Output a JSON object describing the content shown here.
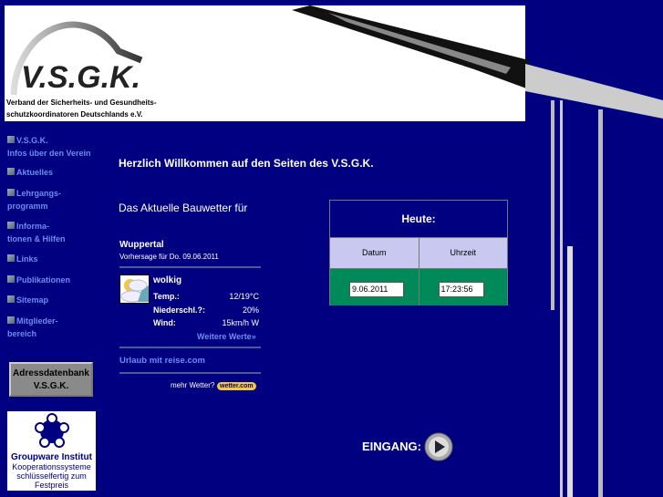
{
  "header": {
    "logo": "V.S.G.K.",
    "subtitle_line1": "Verband der Sicherheits- und Gesundheits-",
    "subtitle_line2": "schutzkoordinatoren Deutschlands e.V."
  },
  "nav": [
    {
      "l1": "V.S.G.K.",
      "l2": "Infos über den Verein"
    },
    {
      "l1": "Aktuelles"
    },
    {
      "l1": "Lehrgangs-",
      "l2": "programm"
    },
    {
      "l1": "Informa-",
      "l2": "tionen & Hilfen"
    },
    {
      "l1": "Links"
    },
    {
      "l1": "Publikationen"
    },
    {
      "l1": "Sitemap"
    },
    {
      "l1": "Mitglieder-",
      "l2": "bereich"
    }
  ],
  "adress_button": {
    "l1": "Adressdatenbank",
    "l2": "V.S.G.K."
  },
  "groupware": {
    "title": "Groupware Institut",
    "l1": "Kooperationssysteme",
    "l2": "schlüsselfertig zum",
    "l3": "Festpreis"
  },
  "main": {
    "welcome": "Herzlich Willkommen auf den Seiten des V.S.G.K.",
    "weather_heading": "Das Aktuelle Bauwetter für"
  },
  "weather": {
    "city": "Wuppertal",
    "forecast": "Vorhersage für Do. 09.06.2011",
    "condition": "wolkig",
    "rows": [
      {
        "k": "Temp.:",
        "v": "12/19°C"
      },
      {
        "k": "Niederschl.?:",
        "v": "20%"
      },
      {
        "k": "Wind:",
        "v": "15km/h W"
      }
    ],
    "more": "Weitere Werte»",
    "travel": "Urlaub mit reise.com",
    "more_weather": "mehr Wetter?",
    "brand": "wetter.com"
  },
  "today": {
    "title": "Heute:",
    "date_label": "Datum",
    "time_label": "Uhrzeit",
    "date": "9.06.2011",
    "time": "17:23:56"
  },
  "entry": {
    "label": "EINGANG:"
  }
}
